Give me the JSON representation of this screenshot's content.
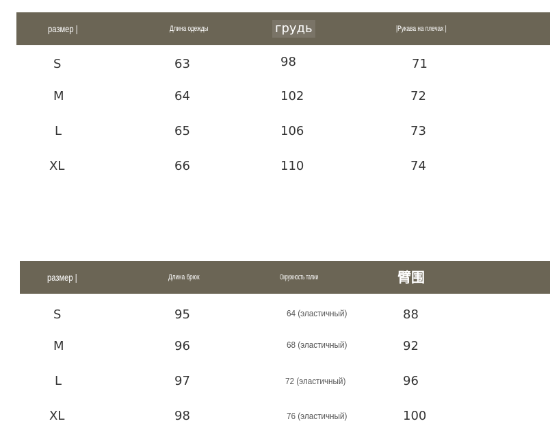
{
  "colors": {
    "header_background": "#6b6555",
    "header_text": "#ffffff",
    "body_text": "#333333",
    "page_background": "#ffffff"
  },
  "table1": {
    "headers": [
      "размер |",
      "Длина одежды",
      "грудь",
      "|Рукава на плечах |"
    ],
    "rows": [
      [
        "S",
        "63",
        "98",
        "71"
      ],
      [
        "M",
        "64",
        "102",
        "72"
      ],
      [
        "L",
        "65",
        "106",
        "73"
      ],
      [
        "XL",
        "66",
        "110",
        "74"
      ]
    ]
  },
  "table2": {
    "headers": [
      "размер |",
      "Длина брюк",
      "Окружность талии",
      "臂围"
    ],
    "rows": [
      [
        "S",
        "95",
        "64 (эластичный)",
        "88"
      ],
      [
        "M",
        "96",
        "68 (эластичный)",
        "92"
      ],
      [
        "L",
        "97",
        "72 (эластичный)",
        "96"
      ],
      [
        "XL",
        "98",
        "76 (эластичный)",
        "100"
      ]
    ]
  }
}
